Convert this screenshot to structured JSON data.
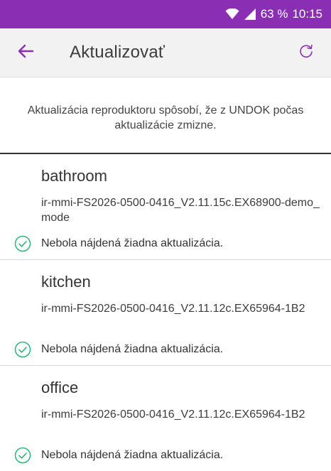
{
  "status_bar": {
    "battery": "63 %",
    "time": "10:15",
    "icons": [
      "wifi-icon",
      "signal-icon"
    ]
  },
  "header": {
    "title": "Aktualizovať",
    "back_icon": "arrow-left-icon",
    "refresh_icon": "refresh-icon"
  },
  "info": {
    "text": "Aktualizácia reproduktoru spôsobí, že z UNDOK počas aktualizácie zmizne."
  },
  "speakers": [
    {
      "name": "bathroom",
      "firmware": "ir-mmi-FS2026-0500-0416_V2.11.15c.EX68900-demo_mode",
      "status": "Nebola nájdená žiadna aktualizácia."
    },
    {
      "name": "kitchen",
      "firmware": "ir-mmi-FS2026-0500-0416_V2.11.12c.EX65964-1B2",
      "status": "Nebola nájdená žiadna aktualizácia."
    },
    {
      "name": "office",
      "firmware": "ir-mmi-FS2026-0500-0416_V2.11.12c.EX65964-1B2",
      "status": "Nebola nájdená žiadna aktualizácia."
    }
  ],
  "colors": {
    "status_bar": "#8a2fb3",
    "accent": "#8a2fb3",
    "check": "#2bb673",
    "app_bar": "#f2f2f2"
  }
}
